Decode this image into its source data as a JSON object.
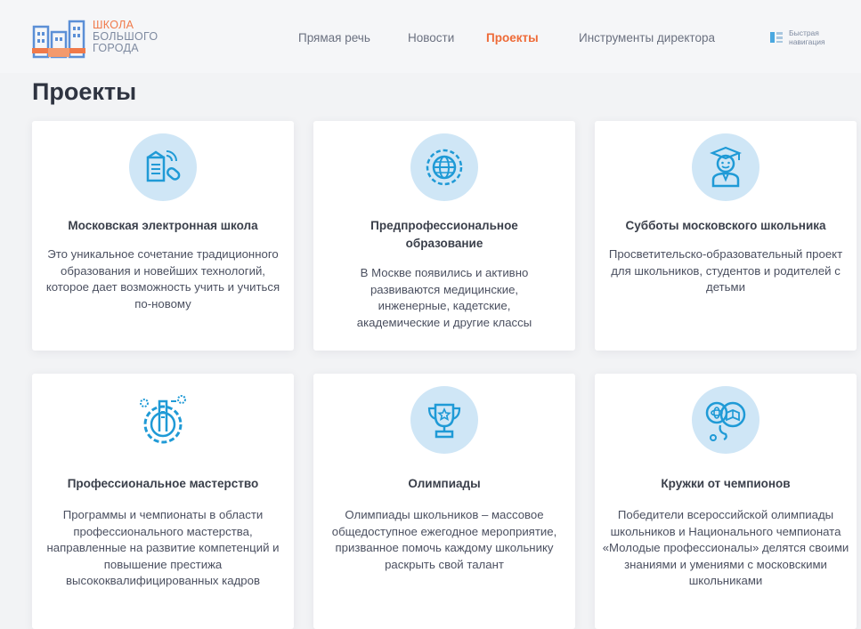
{
  "header": {
    "logo": {
      "line1": "ШКОЛА",
      "line2": "БОЛЬШОГО",
      "line3": "ГОРОДА"
    },
    "nav": [
      {
        "label": "Прямая речь",
        "active": false
      },
      {
        "label": "Новости",
        "active": false
      },
      {
        "label": "Проекты",
        "active": true
      },
      {
        "label": "Инструменты директора",
        "active": false
      }
    ],
    "quick_nav": {
      "line1": "Быстрая",
      "line2": "навигация",
      "icon": "quick-nav-icon"
    }
  },
  "page": {
    "title": "Проекты"
  },
  "cards": [
    {
      "icon": "electronic-school-icon",
      "title": "Московская электронная школа",
      "description": "Это уникальное сочетание традиционного образования и новейших технологий, которое дает возможность учить и учиться по-новому"
    },
    {
      "icon": "globe-gear-icon",
      "title": "Предпрофессиональное образование",
      "description": "В Москве появились и активно развиваются медицинские, инженерные, кадетские, академические и другие классы"
    },
    {
      "icon": "graduate-student-icon",
      "title": "Субботы московского школьника",
      "description": "Просветительско-образовательный проект для школьников, студентов и родителей с детьми"
    },
    {
      "icon": "gear-tools-icon",
      "title": "Профессиональное мастерство",
      "description": "Программы и чемпионаты в области профессионального мастерства, направленные на развитие компетенций и повышение престижа высококвалифицированных кадров"
    },
    {
      "icon": "trophy-icon",
      "title": "Олимпиады",
      "description": "Олимпиады школьников – массовое общедоступное ежегодное мероприятие, призванное помочь каждому школьнику раскрыть свой талант"
    },
    {
      "icon": "science-ideas-icon",
      "title": "Кружки от чемпионов",
      "description": "Победители всероссийской олимпиады школьников и Национального чемпионата «Молодые профессионалы» делятся своими знаниями и умениями с московскими школьниками"
    }
  ],
  "colors": {
    "accent": "#ee6a37",
    "icon_blue": "#1f9ad6",
    "icon_bg": "#cfe6f6",
    "background": "#f2f3f5"
  }
}
